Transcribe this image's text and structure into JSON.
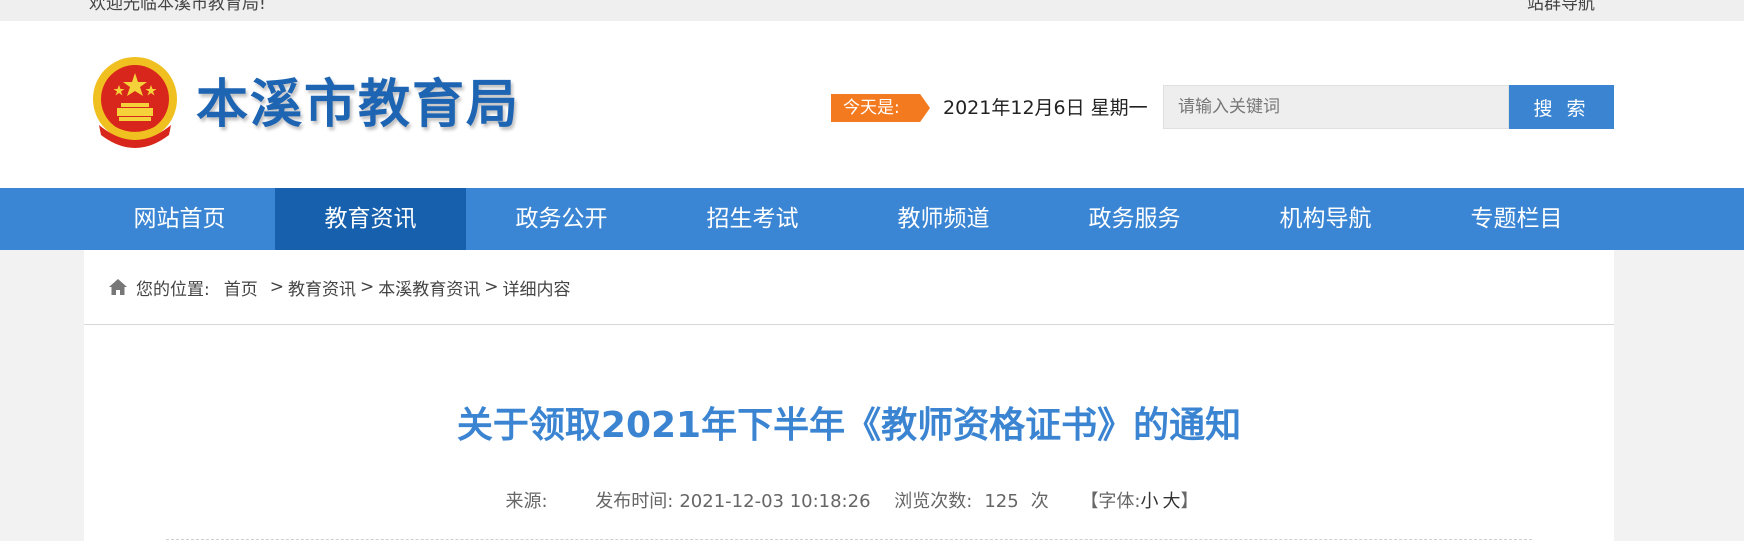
{
  "topbar": {
    "welcome": "欢迎光临本溪市教育局!",
    "sitemap": "站群导航"
  },
  "header": {
    "site_title": "本溪市教育局",
    "today_label": "今天是:",
    "today_date": "2021年12月6日 星期一",
    "search_placeholder": "请输入关键词",
    "search_button": "搜 索"
  },
  "nav": {
    "items": [
      {
        "label": "网站首页"
      },
      {
        "label": "教育资讯"
      },
      {
        "label": "政务公开"
      },
      {
        "label": "招生考试"
      },
      {
        "label": "教师频道"
      },
      {
        "label": "政务服务"
      },
      {
        "label": "机构导航"
      },
      {
        "label": "专题栏目"
      }
    ],
    "active_index": 1
  },
  "breadcrumb": {
    "prefix": "您的位置:",
    "items": [
      "首页",
      "教育资讯",
      "本溪教育资讯",
      "详细内容"
    ],
    "separator": ">"
  },
  "article": {
    "title": "关于领取2021年下半年《教师资格证书》的通知",
    "source_label": "来源:",
    "source_value": "",
    "publish_label": "发布时间:",
    "publish_time": "2021-12-03 10:18:26",
    "views_label": "浏览次数:",
    "views_count": "125",
    "views_unit": "次",
    "font_label_open": "【字体:",
    "font_small": "小",
    "font_large": "大",
    "font_label_close": "】"
  },
  "colors": {
    "brand_blue": "#3b86d4",
    "nav_active": "#1660ad",
    "title_blue": "#3a84d2",
    "accent_orange": "#f47a20"
  }
}
